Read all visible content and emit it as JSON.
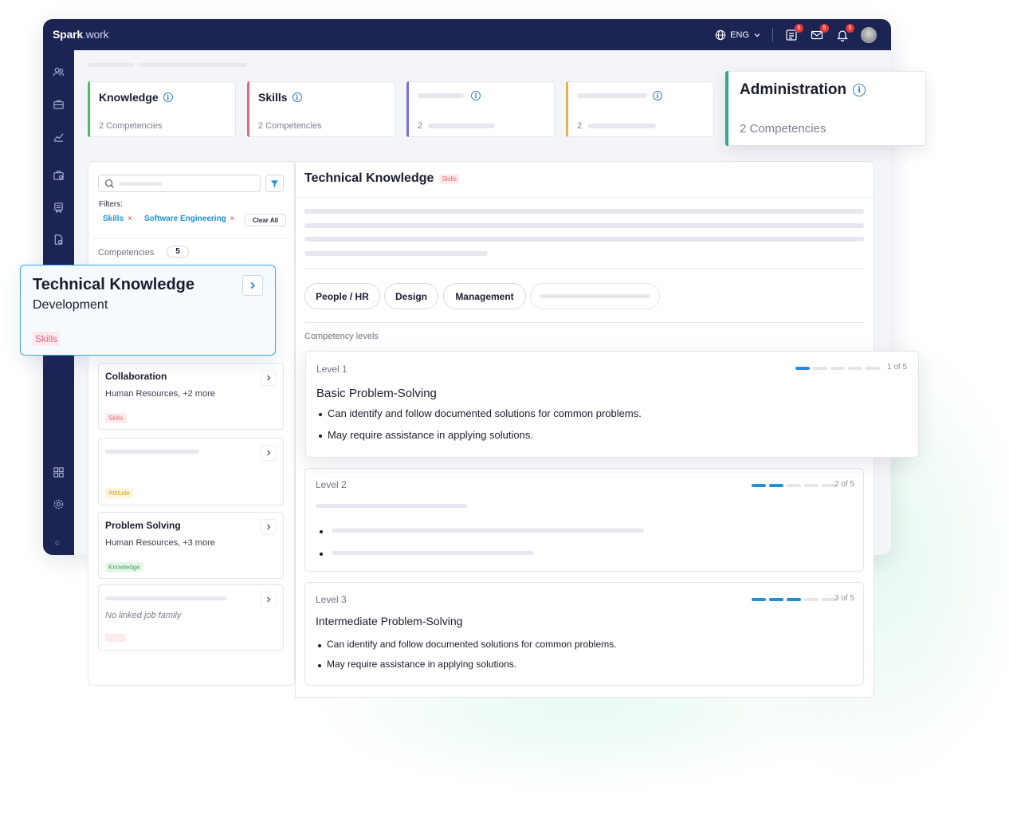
{
  "brand": {
    "name_bold": "Spark",
    "name_light": "work"
  },
  "topbar": {
    "language": "ENG",
    "icons": [
      {
        "name": "tasks-icon",
        "badge": "5"
      },
      {
        "name": "mail-icon",
        "badge": "5"
      },
      {
        "name": "bell-icon",
        "badge": "5"
      }
    ]
  },
  "sidebar": {
    "items": [
      "people-icon",
      "briefcase-icon",
      "chart-icon",
      "job-icon",
      "learning-icon",
      "document-icon",
      "apps-icon",
      "gear-icon"
    ],
    "footer": "©"
  },
  "categories": [
    {
      "title": "Knowledge",
      "count_label": "2 Competencies",
      "color": "#4fbf5a"
    },
    {
      "title": "Skills",
      "count_label": "2 Competencies",
      "color": "#e06a7a"
    },
    {
      "title": "",
      "count_label": "2",
      "color": "#7b6ee0"
    },
    {
      "title": "",
      "count_label": "2",
      "color": "#eab04a"
    }
  ],
  "admin_card": {
    "title": "Administration",
    "count_label": "2 Competencies",
    "color": "#35a58e"
  },
  "left_panel": {
    "filters_label": "Filters:",
    "filter_chips": [
      "Skills",
      "Software Engineering"
    ],
    "clear_all": "Clear All",
    "competencies_label": "Competencies",
    "competencies_count": "5",
    "selected": {
      "title": "Technical Knowledge",
      "subtitle": "Development",
      "tag": "Skills"
    },
    "items": [
      {
        "title": "Collaboration",
        "subtitle": "Human Resources, +2 more",
        "tag": "Skills"
      },
      {
        "title": "",
        "subtitle": "",
        "tag": "Attitude"
      },
      {
        "title": "Problem Solving",
        "subtitle": "Human Resources, +3 more",
        "tag": "Knowledge"
      },
      {
        "title": "",
        "subtitle": "No linked job family",
        "tag": ""
      }
    ]
  },
  "detail": {
    "title": "Technical Knowledge",
    "tag": "Skills",
    "job_families": [
      "People / HR",
      "Design",
      "Management"
    ],
    "levels_label": "Competency levels",
    "levels": [
      {
        "name": "Level 1",
        "count": "1 of 5",
        "filled": 1,
        "title": "Basic Problem-Solving",
        "bullets": [
          "Can identify and follow documented solutions for common problems.",
          "May require assistance in applying solutions."
        ]
      },
      {
        "name": "Level 2",
        "count": "2 of 5",
        "filled": 2,
        "title": "",
        "bullets": []
      },
      {
        "name": "Level 3",
        "count": "3 of 5",
        "filled": 3,
        "title": "Intermediate Problem-Solving",
        "bullets": [
          "Can identify and follow documented solutions for common problems.",
          "May require assistance in applying solutions."
        ]
      }
    ]
  }
}
